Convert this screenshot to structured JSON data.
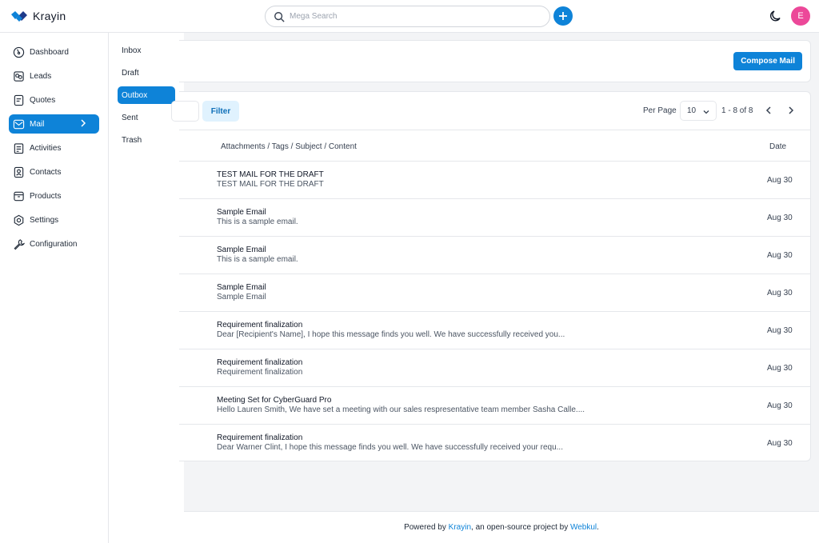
{
  "app": {
    "name": "Krayin"
  },
  "search": {
    "placeholder": "Mega Search"
  },
  "user": {
    "avatar_letter": "E",
    "avatar_color": "#ec4899"
  },
  "colors": {
    "accent": "#0e83d8"
  },
  "sidebar": {
    "items": [
      {
        "label": "Dashboard",
        "icon": "dashboard-icon"
      },
      {
        "label": "Leads",
        "icon": "leads-icon"
      },
      {
        "label": "Quotes",
        "icon": "quotes-icon"
      },
      {
        "label": "Mail",
        "icon": "mail-icon",
        "active": true
      },
      {
        "label": "Activities",
        "icon": "activities-icon"
      },
      {
        "label": "Contacts",
        "icon": "contacts-icon"
      },
      {
        "label": "Products",
        "icon": "products-icon"
      },
      {
        "label": "Settings",
        "icon": "settings-icon"
      },
      {
        "label": "Configuration",
        "icon": "configuration-icon"
      }
    ]
  },
  "subnav": {
    "items": [
      "Inbox",
      "Draft",
      "Outbox",
      "Sent",
      "Trash"
    ],
    "active": "Outbox"
  },
  "main": {
    "compose_label": "Compose Mail",
    "filter_label": "Filter",
    "per_page_label": "Per Page",
    "per_page_value": "10",
    "pagination_text": "1 - 8 of 8",
    "columns": {
      "subject": "Attachments / Tags / Subject / Content",
      "date": "Date"
    },
    "rows": [
      {
        "subject": "TEST MAIL FOR THE DRAFT",
        "content": "TEST MAIL FOR THE DRAFT",
        "date": "Aug 30"
      },
      {
        "subject": "Sample Email",
        "content": "This is a sample email.",
        "date": "Aug 30"
      },
      {
        "subject": "Sample Email",
        "content": "This is a sample email.",
        "date": "Aug 30"
      },
      {
        "subject": "Sample Email",
        "content": "Sample Email",
        "date": "Aug 30"
      },
      {
        "subject": "Requirement finalization",
        "content": "Dear [Recipient's Name], I hope this message finds you well. We have successfully received you...",
        "date": "Aug 30"
      },
      {
        "subject": "Requirement finalization",
        "content": "Requirement finalization",
        "date": "Aug 30"
      },
      {
        "subject": "Meeting Set for CyberGuard Pro",
        "content": "Hello Lauren Smith, We have set a meeting with our sales respresentative team member Sasha Calle....",
        "date": "Aug 30"
      },
      {
        "subject": "Requirement finalization",
        "content": "Dear Warner Clint, I hope this message finds you well. We have successfully received your requ...",
        "date": "Aug 30"
      }
    ]
  },
  "footer": {
    "prefix": "Powered by ",
    "link1": "Krayin",
    "middle": ", an open-source project by ",
    "link2": "Webkul",
    "suffix": "."
  }
}
